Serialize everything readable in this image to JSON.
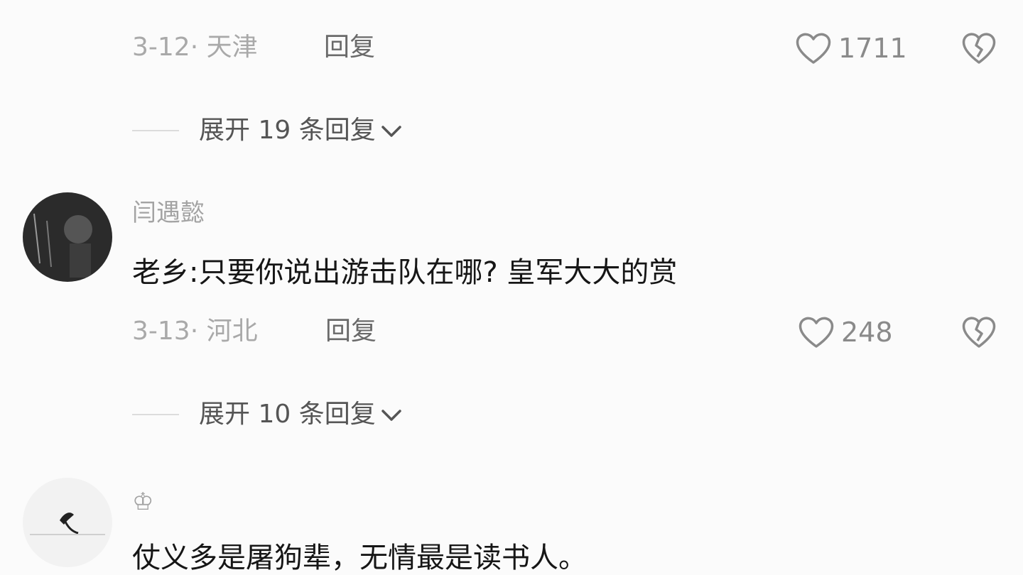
{
  "comments": [
    {
      "partial_text": "",
      "date_location": "3-12· 天津",
      "reply_label": "回复",
      "likes": "1711",
      "expand_label": "展开 19 条回复"
    },
    {
      "username": "闫遇懿",
      "text": "老乡:只要你说出游击队在哪? 皇军大大的赏",
      "date_location": "3-13· 河北",
      "reply_label": "回复",
      "likes": "248",
      "expand_label": "展开 10 条回复"
    },
    {
      "username": "♔",
      "text": "仗义多是屠狗辈，无情最是读书人。"
    }
  ],
  "icons": {
    "like": "heart-outline-icon",
    "dislike": "broken-heart-icon",
    "expand": "chevron-down-icon"
  },
  "colors": {
    "background": "#fbfbfb",
    "meta_text": "#a9a9a9",
    "primary_text": "#161616"
  }
}
